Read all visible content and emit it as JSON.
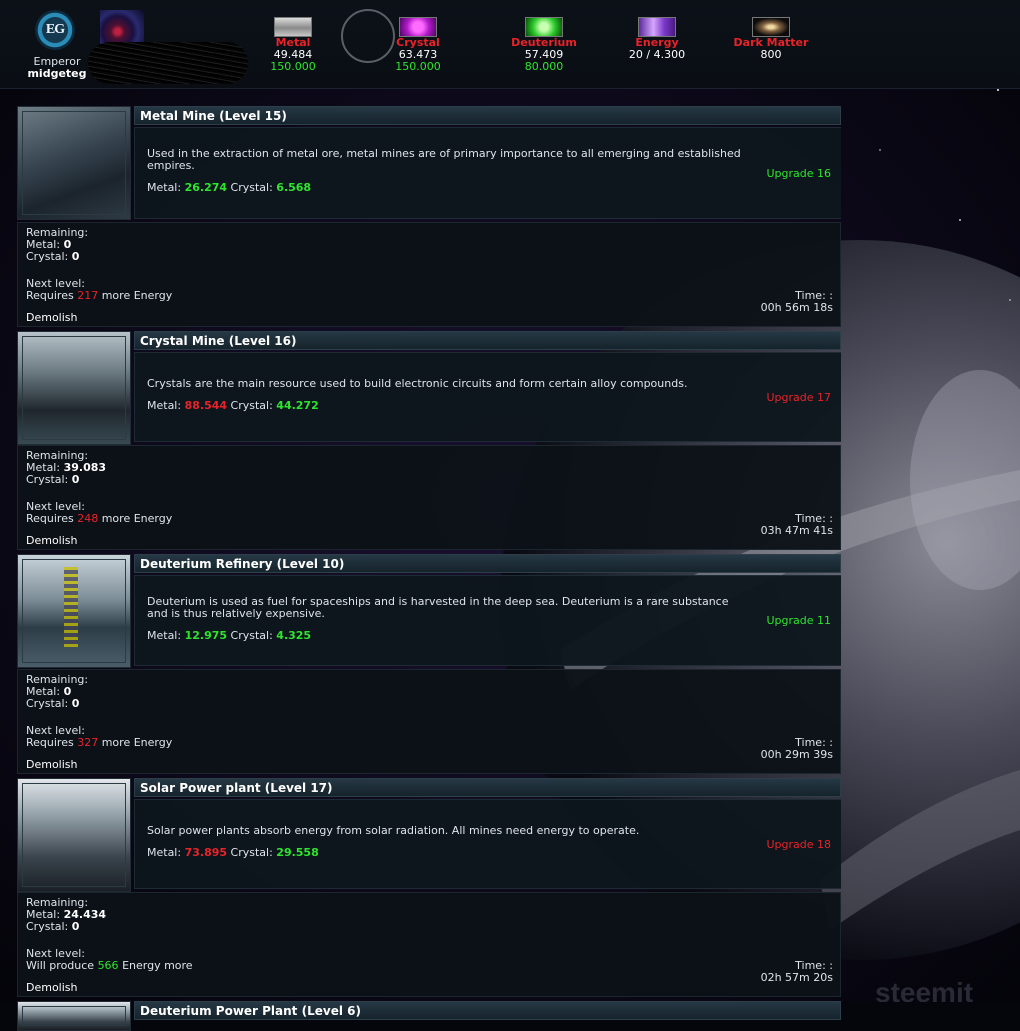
{
  "header": {
    "emblem_label": "EG",
    "rank": "Emperor",
    "player": "midgeteg",
    "resources": [
      {
        "name": "Metal",
        "value": "49.484",
        "capacity": "150.000",
        "icon": "metal-icon"
      },
      {
        "name": "Crystal",
        "value": "63.473",
        "capacity": "150.000",
        "icon": "crystal-icon"
      },
      {
        "name": "Deuterium",
        "value": "57.409",
        "capacity": "80.000",
        "icon": "deuterium-icon"
      },
      {
        "name": "Energy",
        "value": "20 / 4.300",
        "icon": "energy-icon"
      },
      {
        "name": "Dark Matter",
        "value": "800",
        "icon": "dark-matter-icon"
      }
    ]
  },
  "buildings": [
    {
      "title": "Metal Mine (Level 15)",
      "description": "Used in the extraction of metal ore, metal mines are of primary importance to all emerging and established empires.",
      "metal_label": "Metal:",
      "metal_cost": "26.274",
      "crystal_label": "Crystal:",
      "crystal_cost": "6.568",
      "upgrade": "Upgrade 16",
      "remaining_label": "Remaining:",
      "remaining_metal": "0",
      "remaining_crystal": "0",
      "next_label": "Next level:",
      "next_prefix": "Requires",
      "next_amount": "217",
      "next_suffix": "more Energy",
      "time_label": "Time: :",
      "time": "00h 56m 18s",
      "demolish": "Demolish"
    },
    {
      "title": "Crystal Mine (Level 16)",
      "description": "Crystals are the main resource used to build electronic circuits and form certain alloy compounds.",
      "metal_label": "Metal:",
      "metal_cost": "88.544",
      "crystal_label": "Crystal:",
      "crystal_cost": "44.272",
      "upgrade": "Upgrade 17",
      "remaining_label": "Remaining:",
      "remaining_metal": "39.083",
      "remaining_crystal": "0",
      "next_label": "Next level:",
      "next_prefix": "Requires",
      "next_amount": "248",
      "next_suffix": "more Energy",
      "time_label": "Time: :",
      "time": "03h 47m 41s",
      "demolish": "Demolish"
    },
    {
      "title": "Deuterium Refinery (Level 10)",
      "description": "Deuterium is used as fuel for spaceships and is harvested in the deep sea. Deuterium is a rare substance and is thus relatively expensive.",
      "metal_label": "Metal:",
      "metal_cost": "12.975",
      "crystal_label": "Crystal:",
      "crystal_cost": "4.325",
      "upgrade": "Upgrade 11",
      "remaining_label": "Remaining:",
      "remaining_metal": "0",
      "remaining_crystal": "0",
      "next_label": "Next level:",
      "next_prefix": "Requires",
      "next_amount": "327",
      "next_suffix": "more Energy",
      "time_label": "Time: :",
      "time": "00h 29m 39s",
      "demolish": "Demolish"
    },
    {
      "title": "Solar Power plant (Level 17)",
      "description": "Solar power plants absorb energy from solar radiation. All mines need energy to operate.",
      "metal_label": "Metal:",
      "metal_cost": "73.895",
      "crystal_label": "Crystal:",
      "crystal_cost": "29.558",
      "upgrade": "Upgrade 18",
      "remaining_label": "Remaining:",
      "remaining_metal": "24.434",
      "remaining_crystal": "0",
      "next_label": "Next level:",
      "next_prefix": "Will produce",
      "next_amount": "566",
      "next_suffix": "Energy more",
      "time_label": "Time: :",
      "time": "02h 57m 20s",
      "demolish": "Demolish"
    }
  ],
  "partial_building": {
    "title": "Deuterium Power Plant (Level 6)"
  },
  "colors": {
    "affordable": "#2ee52e",
    "unaffordable": "#e8232a",
    "title_bar": "#1e2f3a",
    "panel": "#0e161d"
  }
}
